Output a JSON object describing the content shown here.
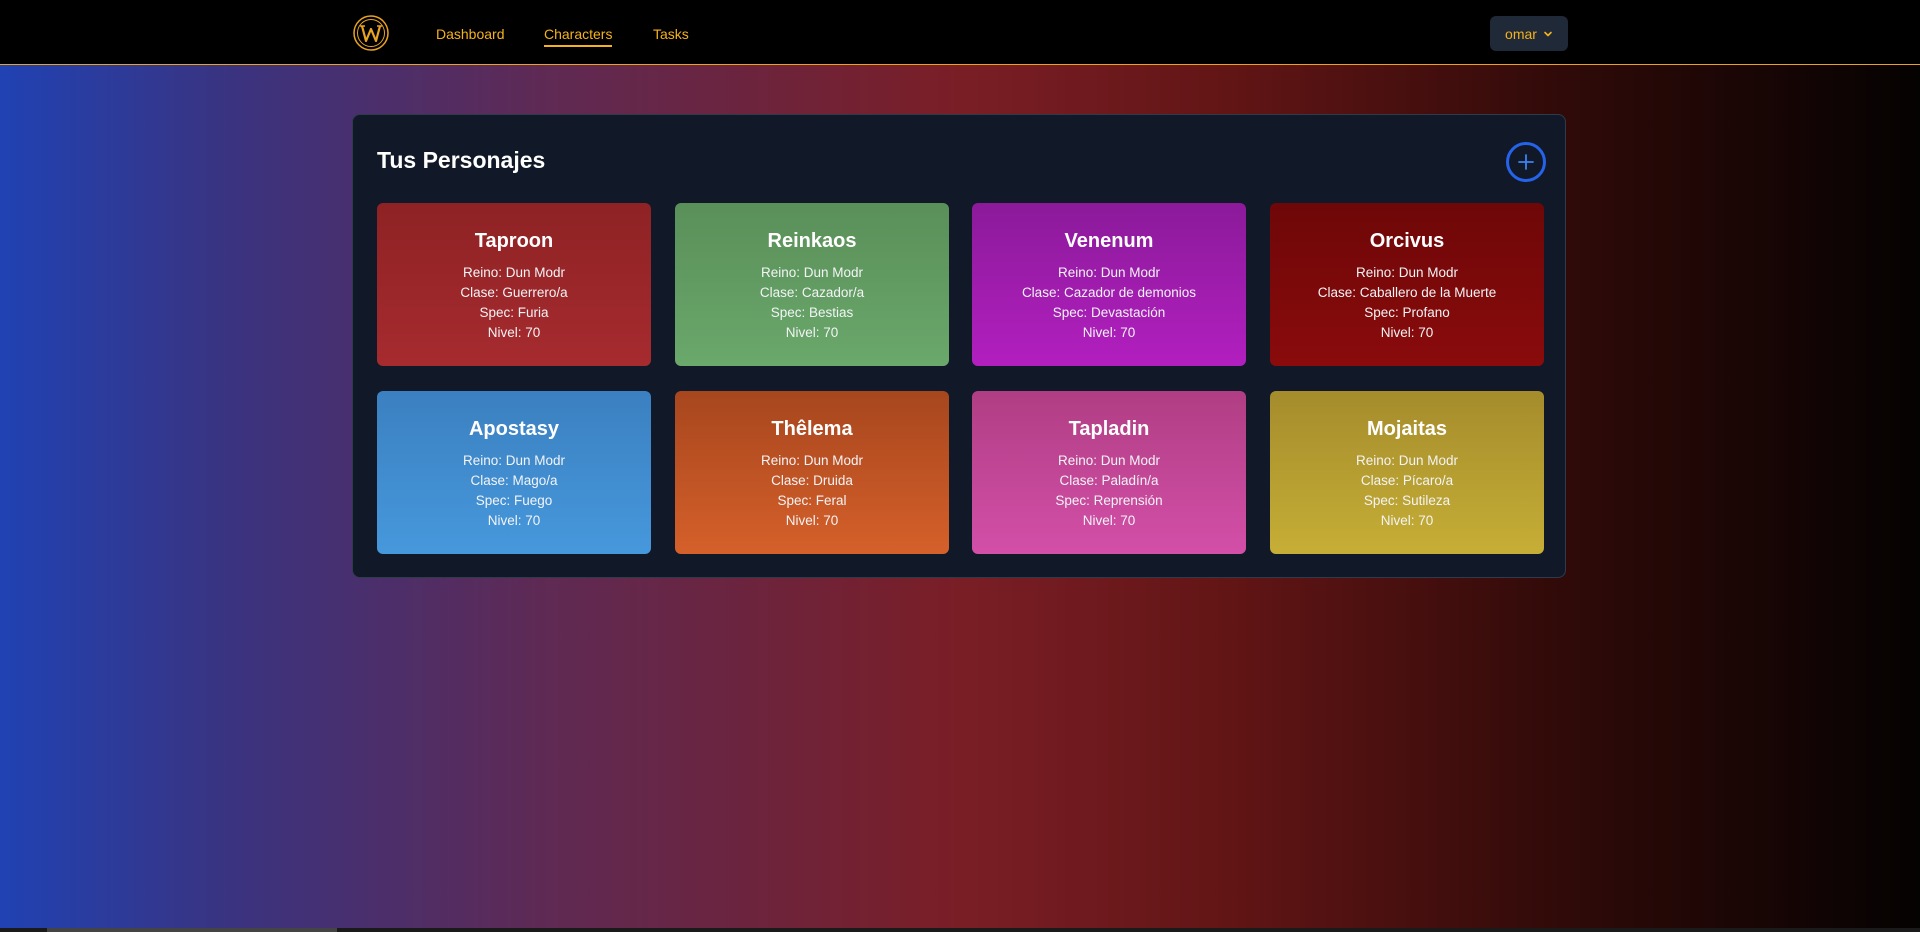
{
  "nav": {
    "links": [
      {
        "label": "Dashboard"
      },
      {
        "label": "Characters"
      },
      {
        "label": "Tasks"
      }
    ],
    "user": "omar",
    "accent": "#f5b21c"
  },
  "main": {
    "title": "Tus Personajes",
    "add_icon": "plus-circle-icon",
    "characters": [
      {
        "name": "Taproon",
        "realm": "Reino: Dun Modr",
        "class": "Clase: Guerrero/a",
        "spec": "Spec: Furia",
        "level": "Nivel: 70",
        "colors": [
          "#8e2224",
          "#a62b2f"
        ]
      },
      {
        "name": "Reinkaos",
        "realm": "Reino: Dun Modr",
        "class": "Clase: Cazador/a",
        "spec": "Spec: Bestias",
        "level": "Nivel: 70",
        "colors": [
          "#5a8f59",
          "#6aa86b"
        ]
      },
      {
        "name": "Venenum",
        "realm": "Reino: Dun Modr",
        "class": "Clase: Cazador de demonios",
        "spec": "Spec: Devastación",
        "level": "Nivel: 70",
        "colors": [
          "#8b1a9a",
          "#b21fbf"
        ]
      },
      {
        "name": "Orcivus",
        "realm": "Reino: Dun Modr",
        "class": "Clase: Caballero de la Muerte",
        "spec": "Spec: Profano",
        "level": "Nivel: 70",
        "colors": [
          "#6e0708",
          "#8a0b0c"
        ]
      },
      {
        "name": "Apostasy",
        "realm": "Reino: Dun Modr",
        "class": "Clase: Mago/a",
        "spec": "Spec: Fuego",
        "level": "Nivel: 70",
        "colors": [
          "#3b80c0",
          "#4698dc"
        ]
      },
      {
        "name": "Thêlema",
        "realm": "Reino: Dun Modr",
        "class": "Clase: Druida",
        "spec": "Spec: Feral",
        "level": "Nivel: 70",
        "colors": [
          "#a7461e",
          "#d5602a"
        ]
      },
      {
        "name": "Tapladin",
        "realm": "Reino: Dun Modr",
        "class": "Clase: Paladín/a",
        "spec": "Spec: Reprensión",
        "level": "Nivel: 70",
        "colors": [
          "#b03e84",
          "#d34fa8"
        ]
      },
      {
        "name": "Mojaitas",
        "realm": "Reino: Dun Modr",
        "class": "Clase: Pícaro/a",
        "spec": "Spec: Sutileza",
        "level": "Nivel: 70",
        "colors": [
          "#a58c2c",
          "#c6ae36"
        ]
      }
    ]
  }
}
